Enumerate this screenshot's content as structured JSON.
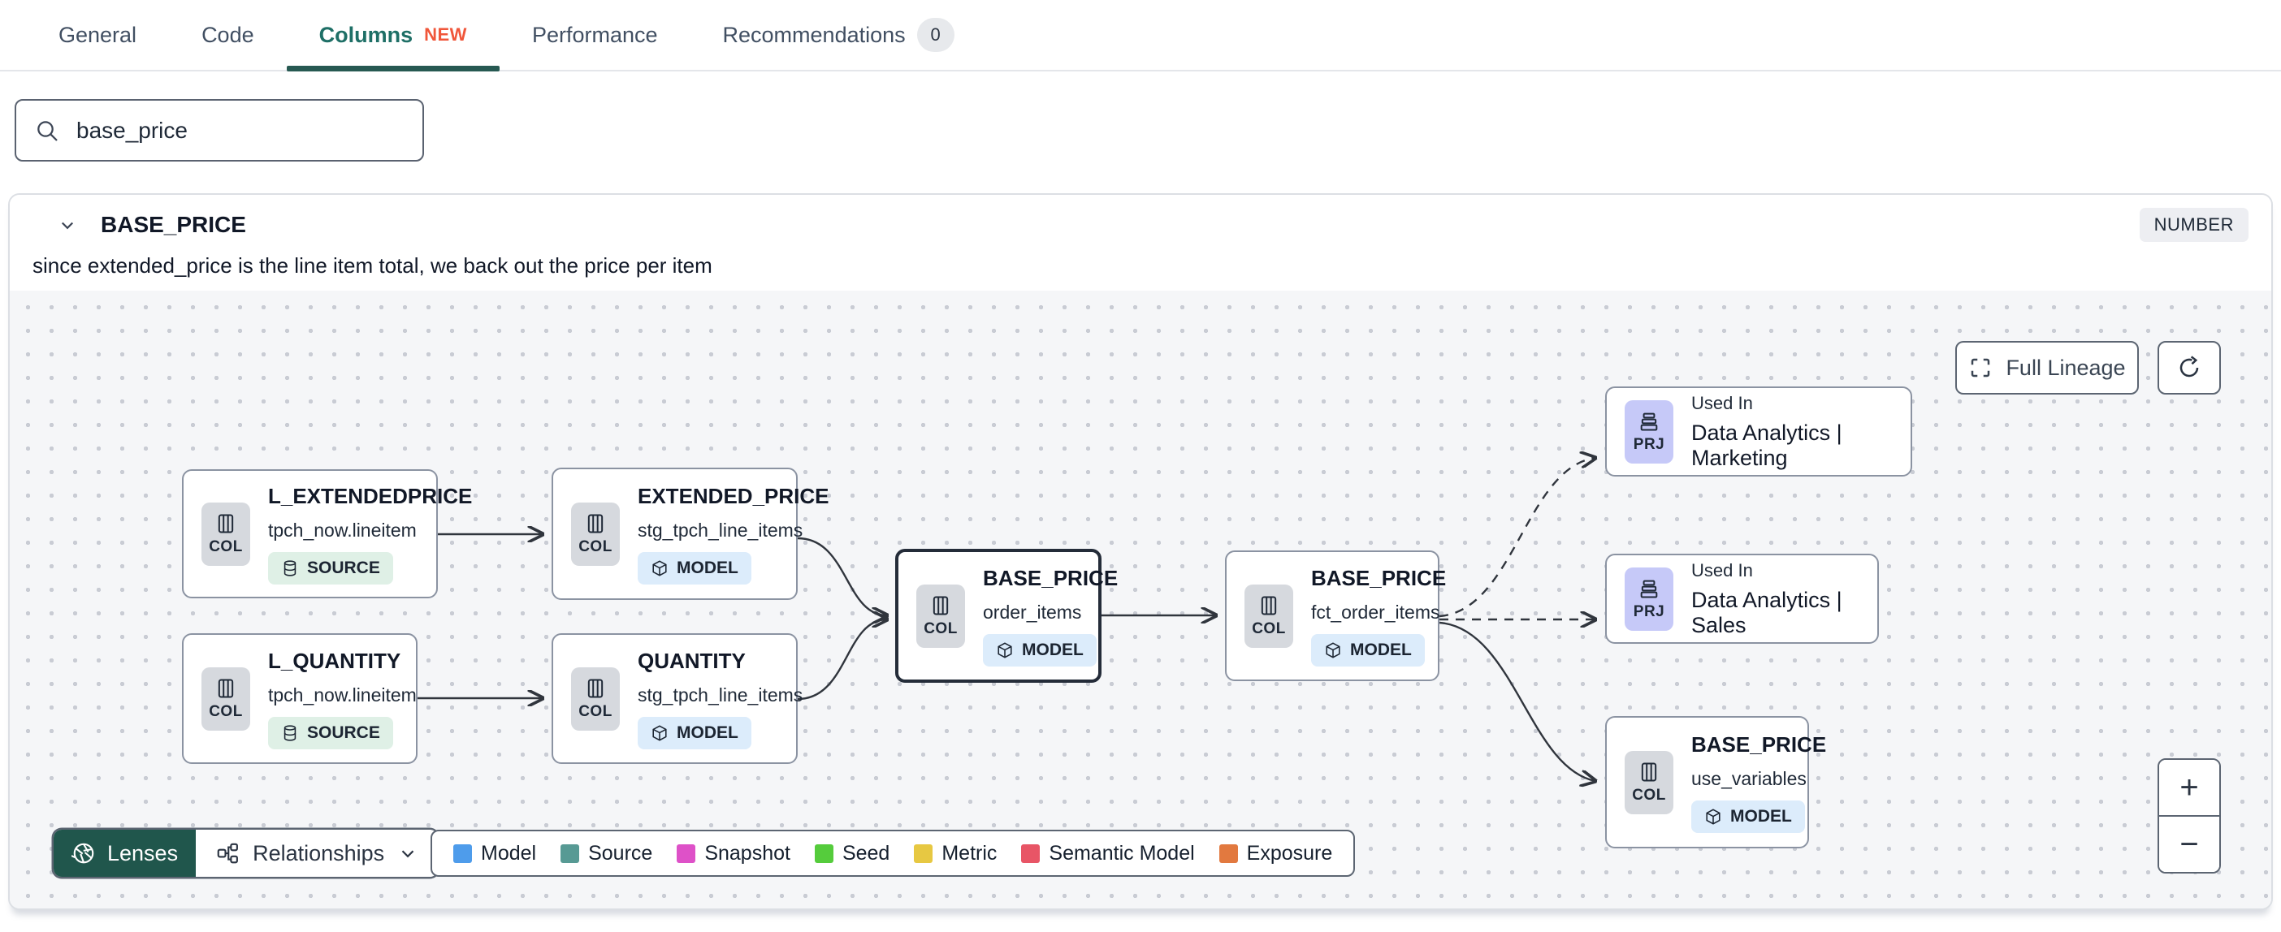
{
  "tabs": [
    {
      "label": "General"
    },
    {
      "label": "Code"
    },
    {
      "label": "Columns",
      "badge": "NEW",
      "active": true
    },
    {
      "label": "Performance"
    },
    {
      "label": "Recommendations",
      "count": "0"
    }
  ],
  "search": {
    "value": "base_price"
  },
  "column_panel": {
    "name": "BASE_PRICE",
    "type_badge": "NUMBER",
    "description": "since extended_price is the line item total, we back out the price per item"
  },
  "lineage": {
    "toolbar": {
      "full_lineage_label": "Full Lineage"
    },
    "nodes": [
      {
        "icon_label": "COL",
        "title": "L_EXTENDEDPRICE",
        "subtitle": "tpch_now.lineitem",
        "badge": "SOURCE"
      },
      {
        "icon_label": "COL",
        "title": "EXTENDED_PRICE",
        "subtitle": "stg_tpch_line_items",
        "badge": "MODEL"
      },
      {
        "icon_label": "COL",
        "title": "L_QUANTITY",
        "subtitle": "tpch_now.lineitem",
        "badge": "SOURCE"
      },
      {
        "icon_label": "COL",
        "title": "QUANTITY",
        "subtitle": "stg_tpch_line_items",
        "badge": "MODEL"
      },
      {
        "icon_label": "COL",
        "title": "BASE_PRICE",
        "subtitle": "order_items",
        "badge": "MODEL"
      },
      {
        "icon_label": "COL",
        "title": "BASE_PRICE",
        "subtitle": "fct_order_items",
        "badge": "MODEL"
      },
      {
        "icon_label": "PRJ",
        "title": "Used In",
        "subtitle": "Data Analytics | Marketing"
      },
      {
        "icon_label": "PRJ",
        "title": "Used In",
        "subtitle": "Data Analytics | Sales"
      },
      {
        "icon_label": "COL",
        "title": "BASE_PRICE",
        "subtitle": "use_variables",
        "badge": "MODEL"
      }
    ],
    "controls": {
      "lenses_label": "Lenses",
      "relationships_label": "Relationships",
      "zoom_in": "+",
      "zoom_out": "−"
    },
    "legend": {
      "items": [
        {
          "label": "Model",
          "color": "#4e9ceb"
        },
        {
          "label": "Source",
          "color": "#579a94"
        },
        {
          "label": "Snapshot",
          "color": "#de51c8"
        },
        {
          "label": "Seed",
          "color": "#55cc3c"
        },
        {
          "label": "Metric",
          "color": "#e7c842"
        },
        {
          "label": "Semantic Model",
          "color": "#e85566"
        },
        {
          "label": "Exposure",
          "color": "#e2793f"
        }
      ]
    }
  }
}
